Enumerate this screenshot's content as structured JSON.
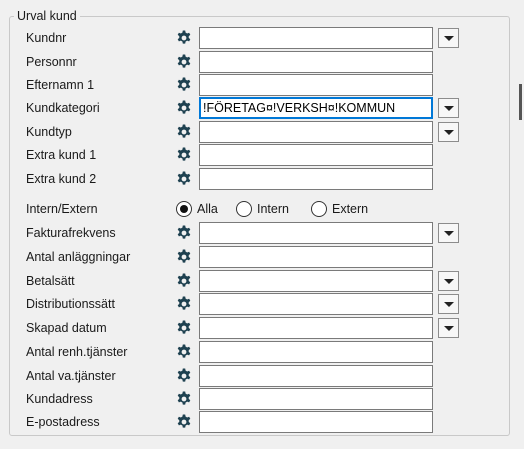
{
  "group": {
    "title": "Urval kund"
  },
  "fields": {
    "kundnr": {
      "label": "Kundnr",
      "value": ""
    },
    "personnr": {
      "label": "Personnr",
      "value": ""
    },
    "efternamn1": {
      "label": "Efternamn 1",
      "value": ""
    },
    "kundkategori": {
      "label": "Kundkategori",
      "value": "!FÖRETAG¤!VERKSH¤!KOMMUN"
    },
    "kundtyp": {
      "label": "Kundtyp",
      "value": ""
    },
    "extrakund1": {
      "label": "Extra kund 1",
      "value": ""
    },
    "extrakund2": {
      "label": "Extra kund 2",
      "value": ""
    },
    "fakturafrekvens": {
      "label": "Fakturafrekvens",
      "value": ""
    },
    "antal_anlaggningar": {
      "label": "Antal anläggningar",
      "value": ""
    },
    "betalsatt": {
      "label": "Betalsätt",
      "value": ""
    },
    "distributionssatt": {
      "label": "Distributionssätt",
      "value": ""
    },
    "skapad_datum": {
      "label": "Skapad datum",
      "value": ""
    },
    "antal_renh": {
      "label": "Antal renh.tjänster",
      "value": ""
    },
    "antal_va": {
      "label": "Antal va.tjänster",
      "value": ""
    },
    "kundadress": {
      "label": "Kundadress",
      "value": ""
    },
    "epostadress": {
      "label": "E-postadress",
      "value": ""
    }
  },
  "intern_extern": {
    "label": "Intern/Extern",
    "options": [
      "Alla",
      "Intern",
      "Extern"
    ],
    "selected": "Alla"
  },
  "icons": {
    "settings": "gear-icon",
    "dropdown": "chevron-down-icon"
  },
  "colors": {
    "focus_border": "#0078d7",
    "background": "#f0f0f0"
  }
}
